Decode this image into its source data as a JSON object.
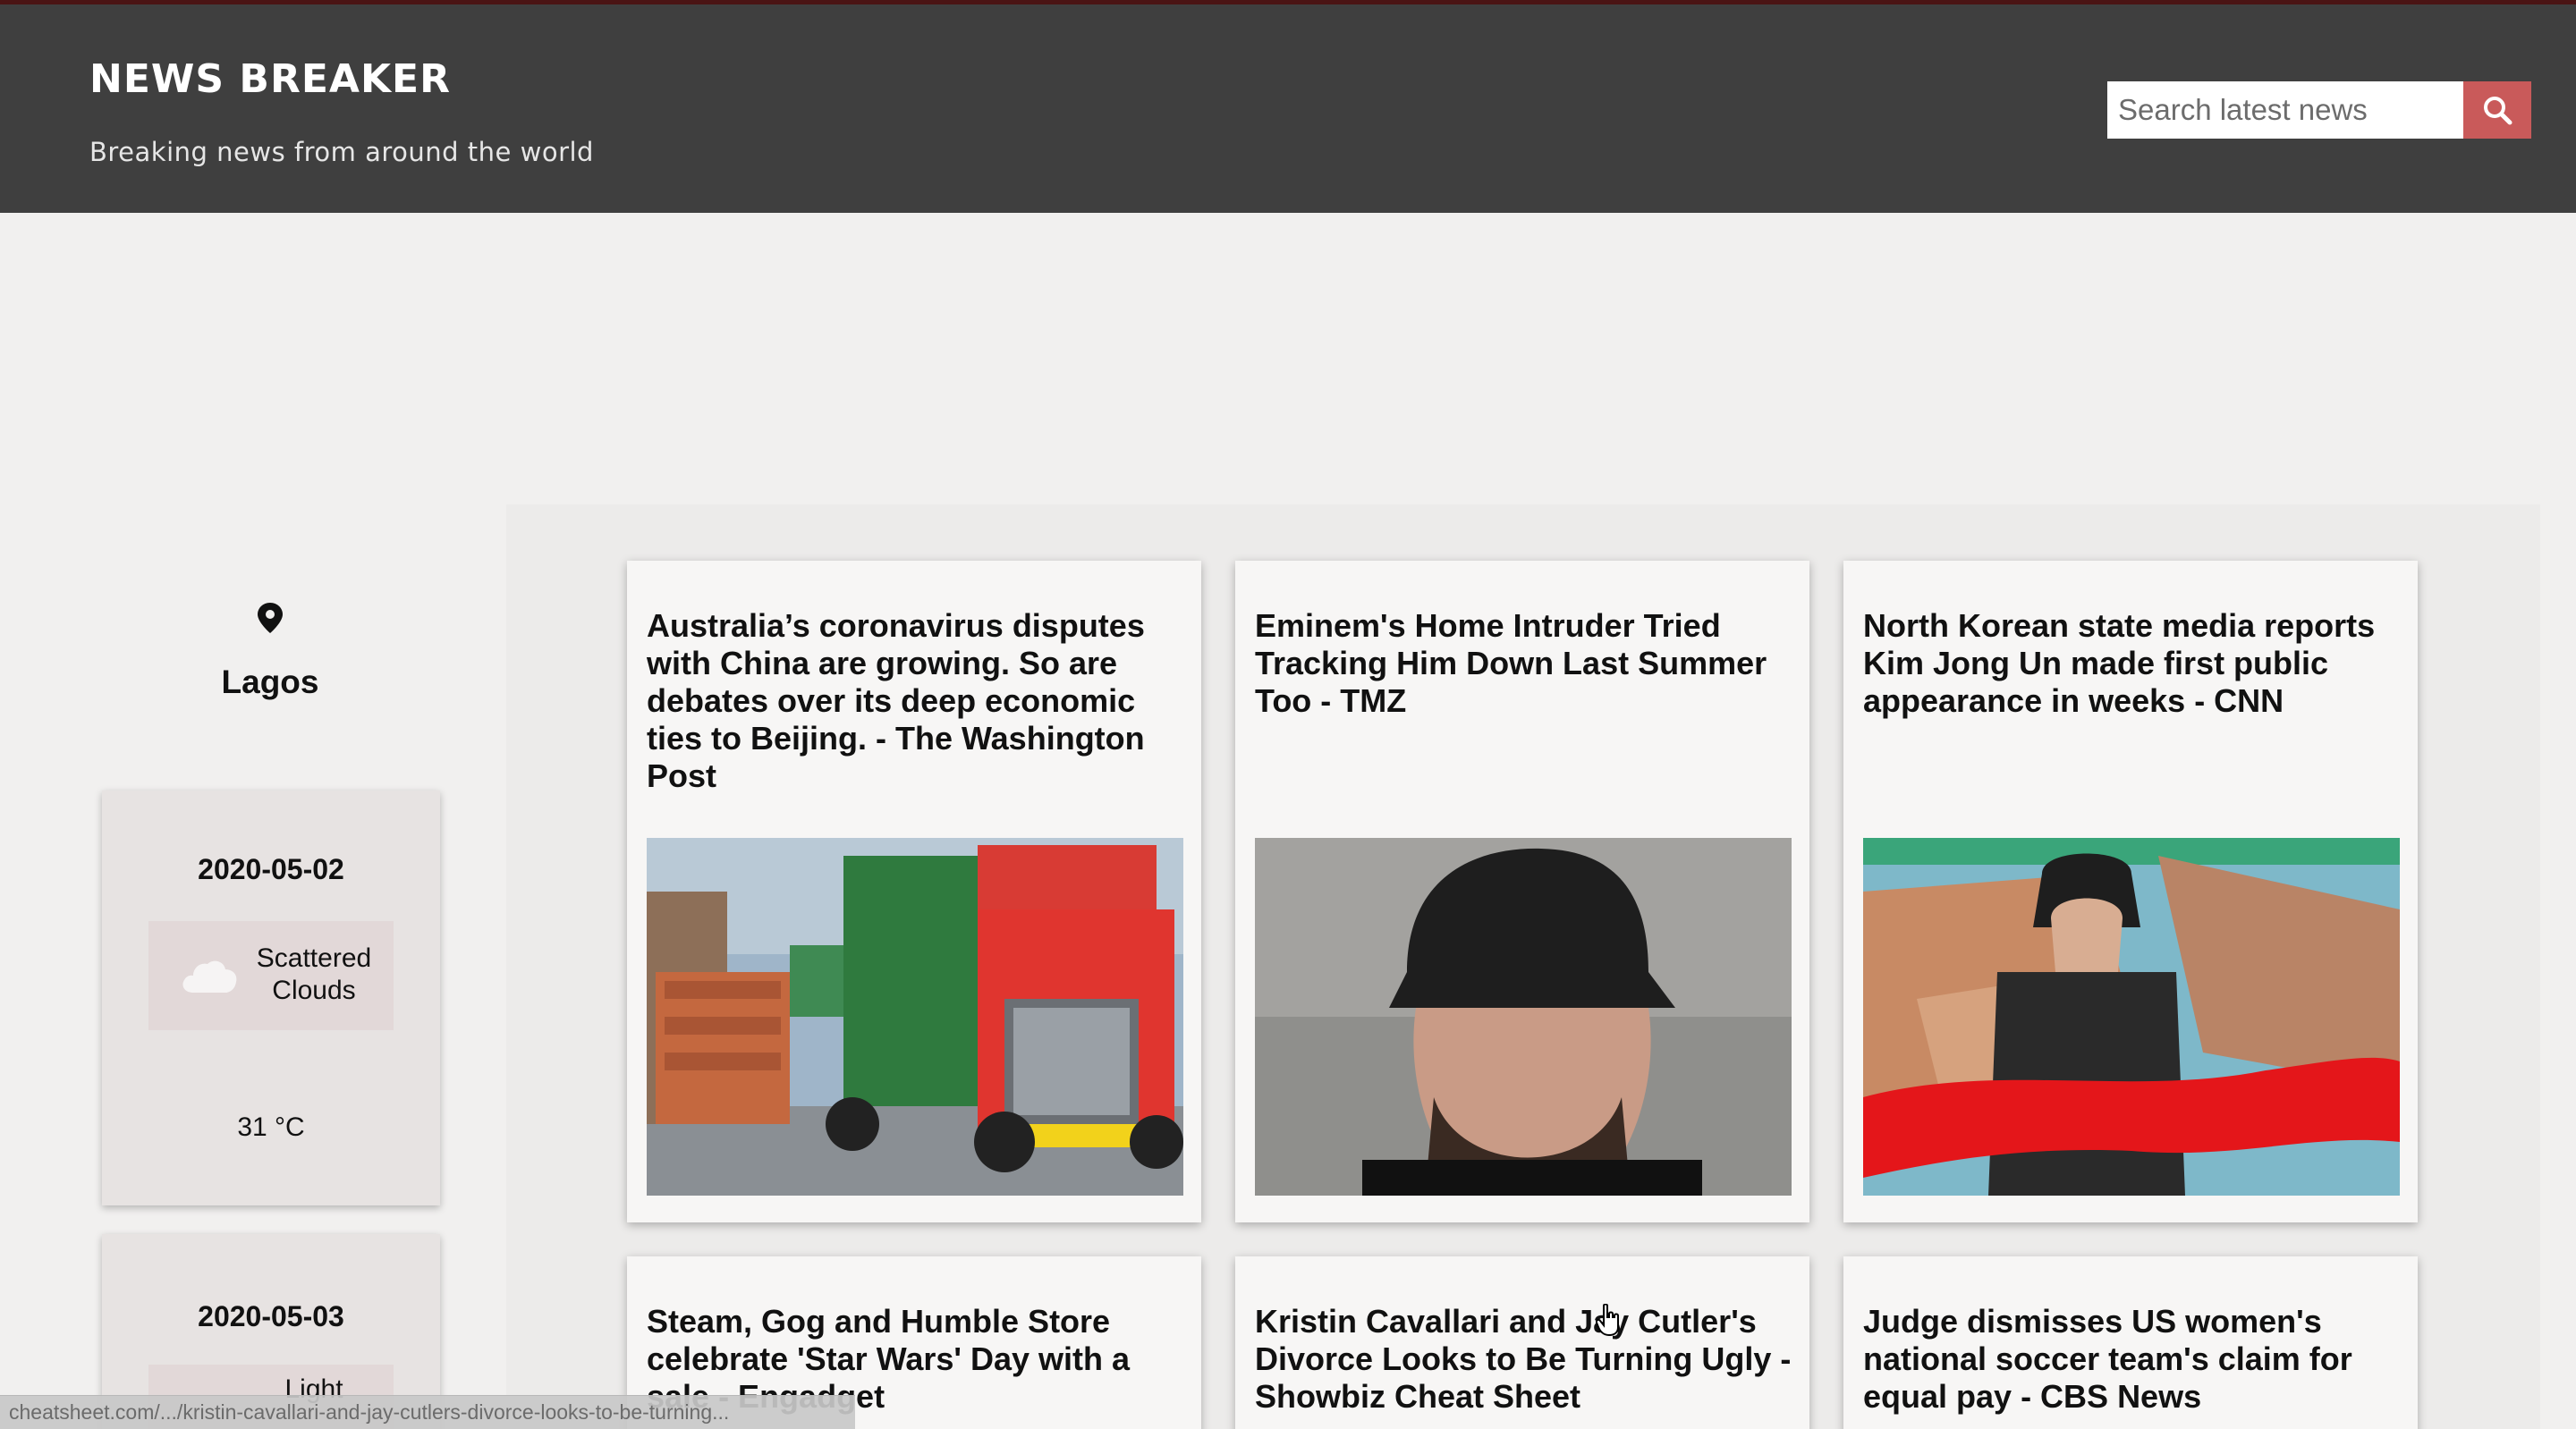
{
  "header": {
    "title": "NEWS BREAKER",
    "tagline": "Breaking news from around the world",
    "search_placeholder": "Search latest news"
  },
  "weather": {
    "location": "Lagos",
    "days": [
      {
        "date": "2020-05-02",
        "condition": "Scattered Clouds",
        "temp": "31 °C"
      },
      {
        "date": "2020-05-03",
        "condition": "Light",
        "temp": ""
      }
    ]
  },
  "news": [
    {
      "title": "Australia’s coronavirus disputes with China are growing. So are debates over its deep economic ties to Beijing. - The Washington Post",
      "image": "shipping-truck-photo"
    },
    {
      "title": "Eminem's Home Intruder Tried Tracking Him Down Last Summer Too - TMZ",
      "image": "man-in-cap-photo"
    },
    {
      "title": "North Korean state media reports Kim Jong Un made first public appearance in weeks - CNN",
      "image": "ribbon-cutting-photo"
    },
    {
      "title": "Steam, Gog and Humble Store celebrate 'Star Wars' Day with a sale - Engadget",
      "image": ""
    },
    {
      "title": "Kristin Cavallari and Jay Cutler's Divorce Looks to Be Turning Ugly - Showbiz Cheat Sheet",
      "image": ""
    },
    {
      "title": "Judge dismisses US women's national soccer team's claim for equal pay - CBS News",
      "image": ""
    }
  ],
  "status_bar": {
    "url": "cheatsheet.com/.../kristin-cavallari-and-jay-cutlers-divorce-looks-to-be-turning..."
  },
  "colors": {
    "header_bg": "#3f3f3f",
    "accent": "#c95a5a",
    "page_bg": "#f1f0ef"
  }
}
